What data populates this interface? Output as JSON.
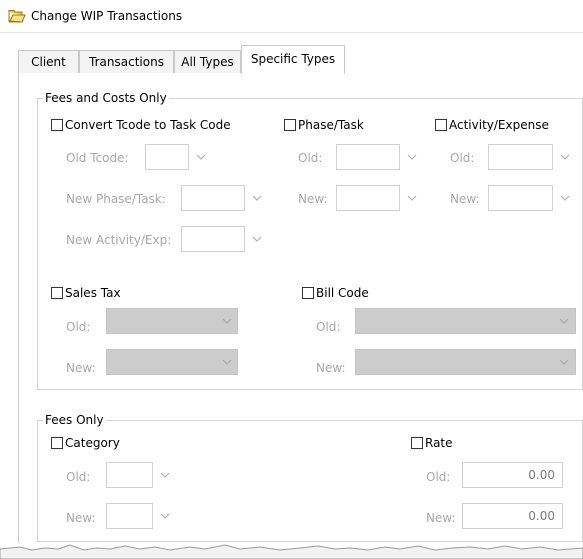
{
  "window": {
    "title": "Change WIP Transactions",
    "icon": "folder-icon"
  },
  "tabs": [
    {
      "label": "Client",
      "active": false
    },
    {
      "label": "Transactions",
      "active": false
    },
    {
      "label": "All Types",
      "active": false
    },
    {
      "label": "Specific Types",
      "active": true
    }
  ],
  "fees_costs": {
    "legend": "Fees and Costs Only",
    "convert": {
      "label": "Convert Tcode to Task Code",
      "checked": false,
      "old_label": "Old Tcode:",
      "new_phase_label": "New Phase/Task:",
      "new_activity_label": "New Activity/Exp:"
    },
    "phase_task": {
      "label": "Phase/Task",
      "checked": false,
      "old_label": "Old:",
      "new_label": "New:"
    },
    "activity_expense": {
      "label": "Activity/Expense",
      "checked": false,
      "old_label": "Old:",
      "new_label": "New:"
    },
    "sales_tax": {
      "label": "Sales Tax",
      "checked": false,
      "old_label": "Old:",
      "new_label": "New:"
    },
    "bill_code": {
      "label": "Bill Code",
      "checked": false,
      "old_label": "Old:",
      "new_label": "New:"
    }
  },
  "fees_only": {
    "legend": "Fees Only",
    "category": {
      "label": "Category",
      "checked": false,
      "old_label": "Old:",
      "new_label": "New:"
    },
    "rate": {
      "label": "Rate",
      "checked": false,
      "old_label": "Old:",
      "new_label": "New:",
      "old_value": "0.00",
      "new_value": "0.00"
    }
  },
  "colors": {
    "disabled_text": "#a8a8a8",
    "disabled_combo": "#cccccc",
    "border": "#c9c9c9"
  }
}
